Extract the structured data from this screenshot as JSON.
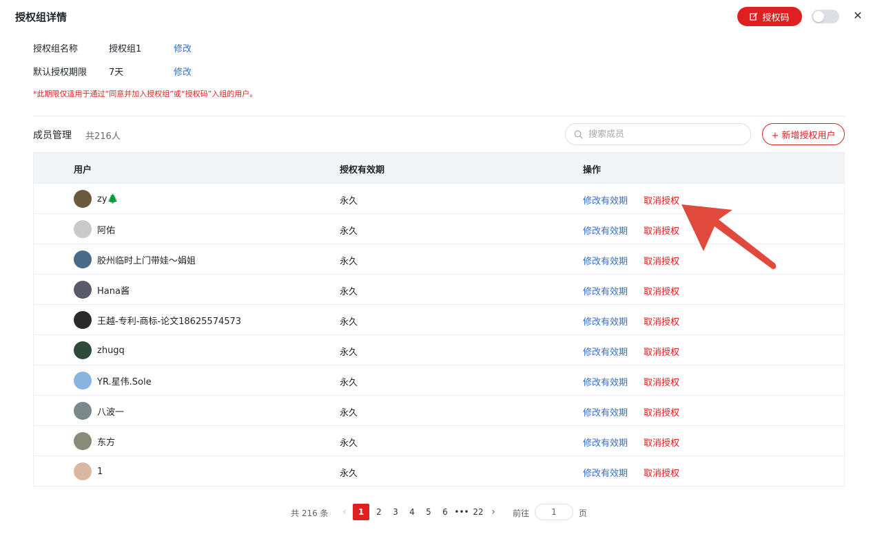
{
  "header": {
    "title": "授权组详情",
    "auth_code_button": "授权码",
    "close_symbol": "✕"
  },
  "info": {
    "group_name_label": "授权组名称",
    "group_name_value": "授权组1",
    "default_period_label": "默认授权期限",
    "default_period_value": "7天",
    "edit_label": "修改",
    "note": "*此期限仅适用于通过“同意并加入授权组”或“授权码”入组的用户。"
  },
  "members": {
    "title": "成员管理",
    "count": "共216人",
    "search_placeholder": "搜索成员",
    "add_button": "+ 新增授权用户"
  },
  "table": {
    "headers": [
      "用户",
      "授权有效期",
      "操作"
    ],
    "edit_action": "修改有效期",
    "revoke_action": "取消授权",
    "rows": [
      {
        "name": "zy🌲",
        "period": "永久",
        "avatar_color": "#6b5a3e"
      },
      {
        "name": "阿佑",
        "period": "永久",
        "avatar_color": "#c9c9c9"
      },
      {
        "name": "胶州临时上门带娃～娟姐",
        "period": "永久",
        "avatar_color": "#4a6a8a"
      },
      {
        "name": "Hana酱",
        "period": "永久",
        "avatar_color": "#5a5a6a"
      },
      {
        "name": "王越-专利-商标-论文18625574573",
        "period": "永久",
        "avatar_color": "#2a2a2a"
      },
      {
        "name": "zhugq",
        "period": "永久",
        "avatar_color": "#2f4a3a"
      },
      {
        "name": "YR.星伟.Sole",
        "period": "永久",
        "avatar_color": "#8ab4e0"
      },
      {
        "name": "八波一",
        "period": "永久",
        "avatar_color": "#7a8a8a"
      },
      {
        "name": "东方",
        "period": "永久",
        "avatar_color": "#8a8a7a"
      },
      {
        "name": "1",
        "period": "永久",
        "avatar_color": "#d8b8a0"
      }
    ]
  },
  "pagination": {
    "total": "共 216 条",
    "prev": "‹",
    "next": "›",
    "pages": [
      "1",
      "2",
      "3",
      "4",
      "5",
      "6",
      "•••",
      "22"
    ],
    "current_page": "1",
    "goto_label": "前往",
    "goto_value": "1",
    "page_suffix": "页"
  },
  "colors": {
    "accent": "#e02020",
    "link": "#3370c8",
    "annotation_arrow": "#e04a3c"
  }
}
